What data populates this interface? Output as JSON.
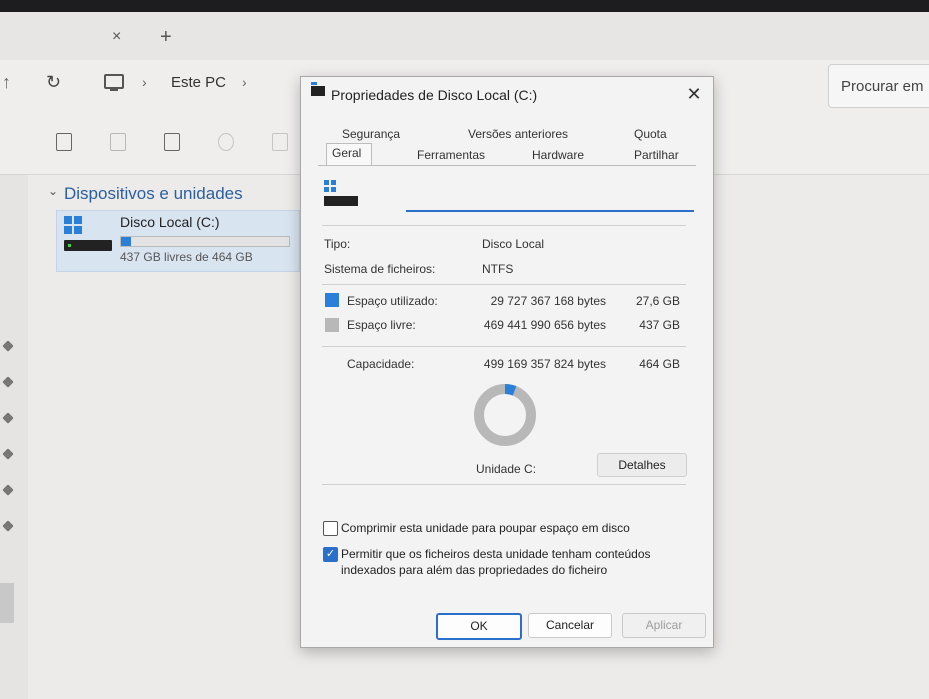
{
  "explorer": {
    "tab_close_glyph": "×",
    "tab_new_glyph": "+",
    "breadcrumb": "Este PC",
    "search_text": "Procurar em",
    "group_header": "Dispositivos e unidades",
    "drive": {
      "name": "Disco Local (C:)",
      "free_text": "437 GB livres de 464 GB",
      "used_fraction": 0.06
    }
  },
  "dialog": {
    "title": "Propriedades de Disco Local (C:)",
    "close_glyph": "✕",
    "tabs_row1": [
      "Segurança",
      "Versões anteriores",
      "Quota"
    ],
    "tabs_row2": [
      "Geral",
      "Ferramentas",
      "Hardware",
      "Partilhar"
    ],
    "active_tab": "Geral",
    "name_value": "",
    "type_label": "Tipo:",
    "type_value": "Disco Local",
    "fs_label": "Sistema de ficheiros:",
    "fs_value": "NTFS",
    "used": {
      "label": "Espaço utilizado:",
      "bytes": "29 727 367 168 bytes",
      "size": "27,6 GB",
      "color": "#2a7fd8"
    },
    "free": {
      "label": "Espaço livre:",
      "bytes": "469 441 990 656 bytes",
      "size": "437 GB",
      "color": "#b8b8b8"
    },
    "capacity": {
      "label": "Capacidade:",
      "bytes": "499 169 357 824 bytes",
      "size": "464 GB"
    },
    "used_fraction": 0.06,
    "drive_label": "Unidade C:",
    "details_button": "Detalhes",
    "compress_label": "Comprimir esta unidade para poupar espaço em disco",
    "compress_checked": false,
    "index_label": "Permitir que os ficheiros desta unidade tenham conteúdos indexados para além das propriedades do ficheiro",
    "index_checked": true,
    "ok_button": "OK",
    "cancel_button": "Cancelar",
    "apply_button": "Aplicar"
  }
}
